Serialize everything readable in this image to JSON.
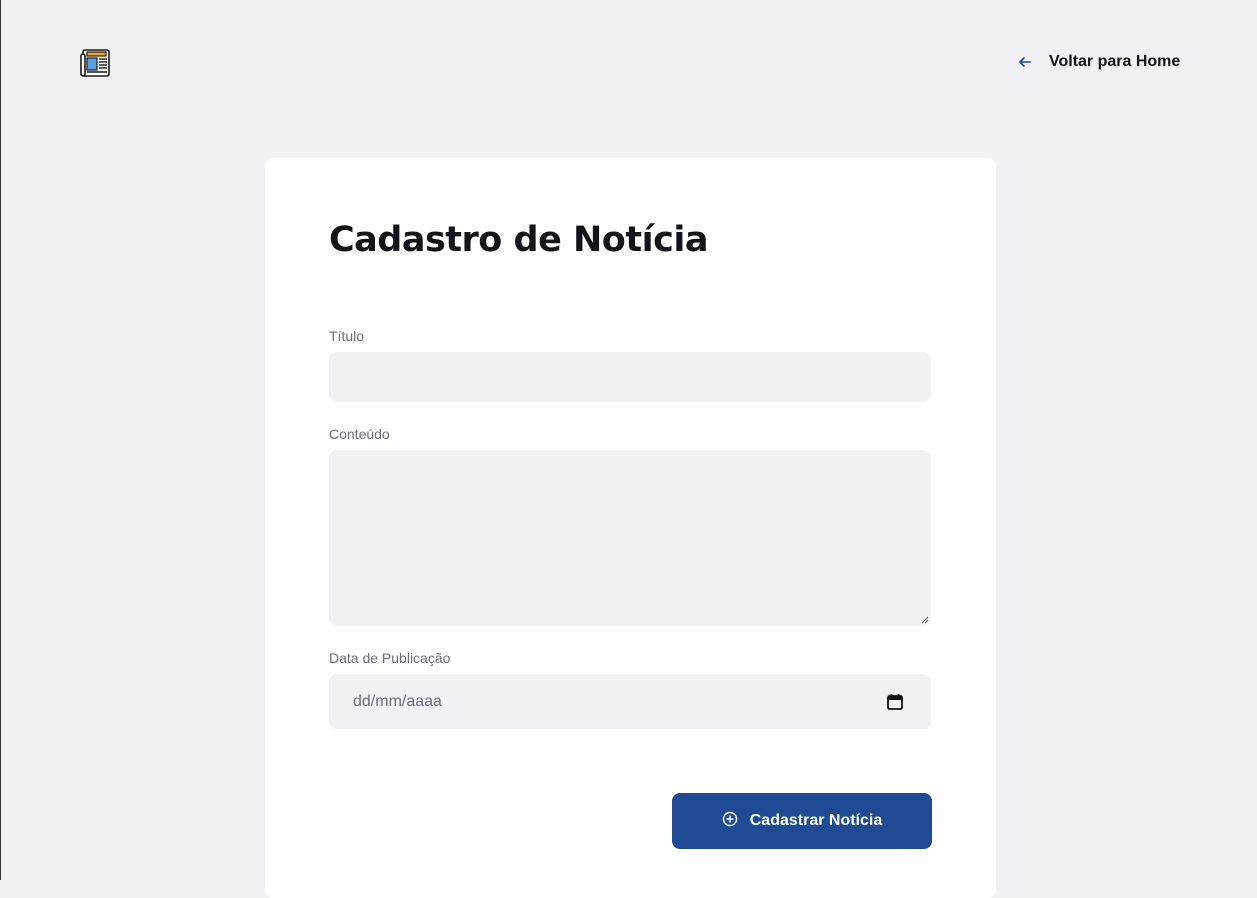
{
  "header": {
    "logo_icon": "newspaper-icon",
    "back_link": {
      "icon": "arrow-left-icon",
      "label": "Voltar para Home"
    }
  },
  "form": {
    "title": "Cadastro de Notícia",
    "fields": {
      "titulo": {
        "label": "Título",
        "value": ""
      },
      "conteudo": {
        "label": "Conteúdo",
        "value": ""
      },
      "data_publicacao": {
        "label": "Data de Publicação",
        "placeholder": "dd/mm/aaaa",
        "icon": "calendar-icon"
      }
    },
    "submit": {
      "icon": "plus-circle-icon",
      "label": "Cadastrar Notícia"
    }
  },
  "colors": {
    "background": "#f0f0f5",
    "card": "#ffffff",
    "input_background": "#f0f0f5",
    "primary": "#1e4b93",
    "title_text": "#13131a",
    "label_text": "#6c6c80"
  }
}
